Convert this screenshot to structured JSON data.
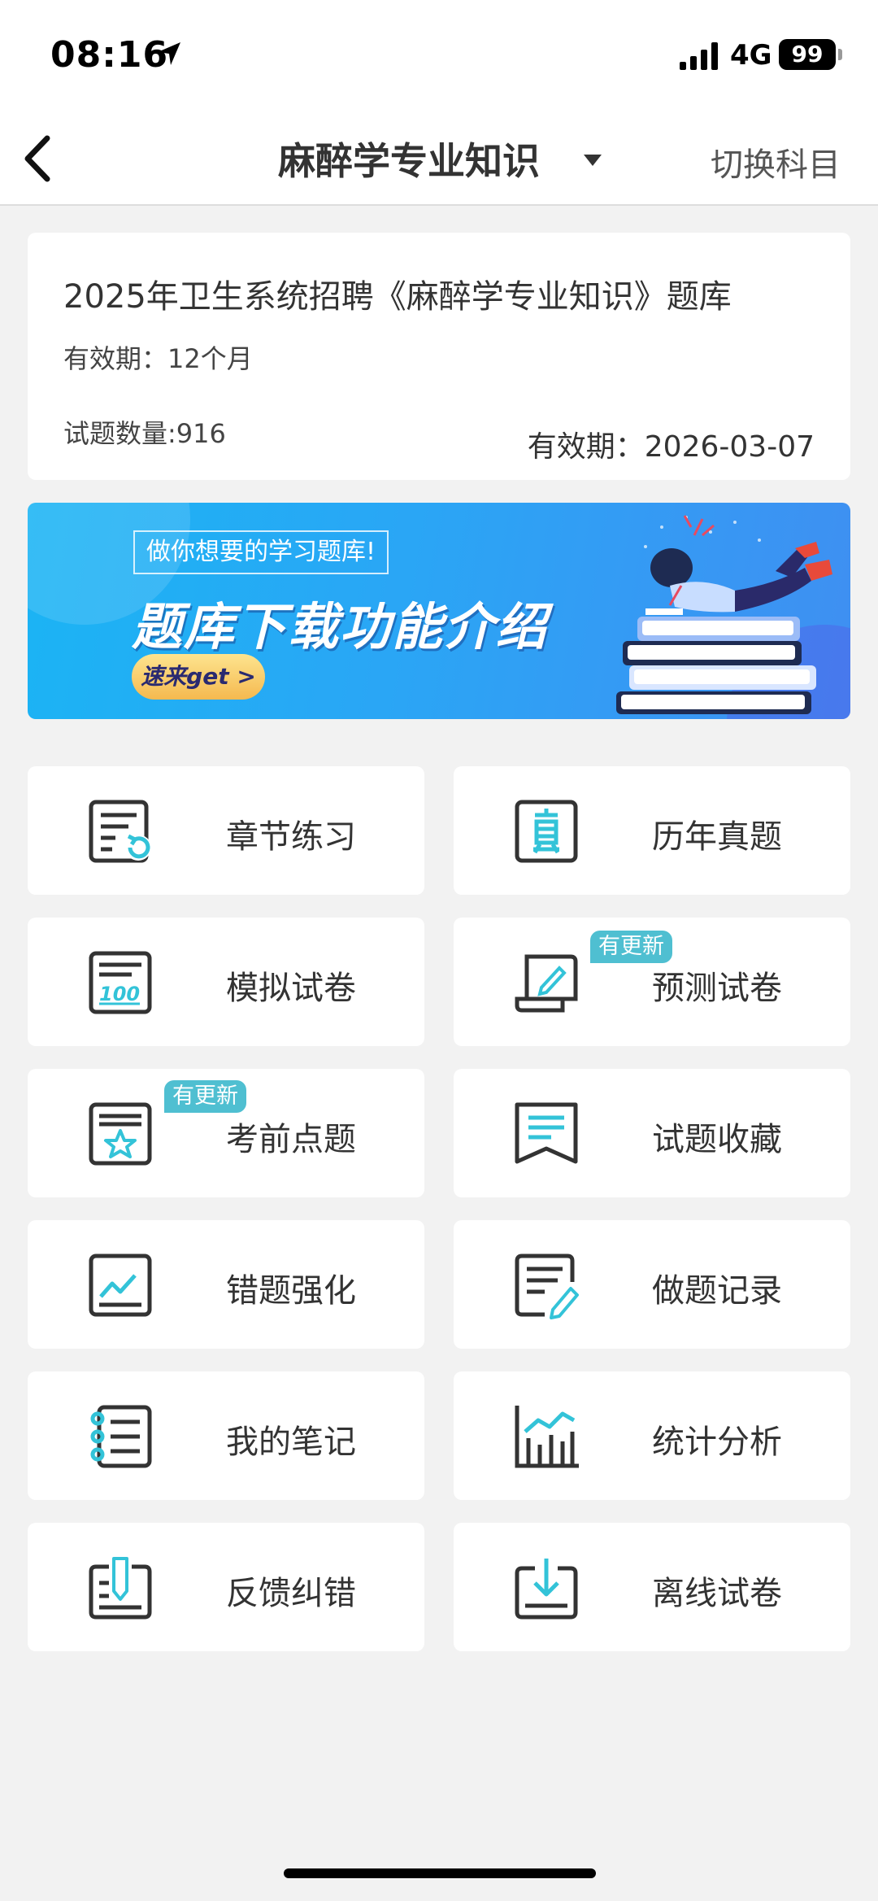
{
  "status_bar": {
    "time": "08:16",
    "network": "4G",
    "battery": "99"
  },
  "nav": {
    "title": "麻醉学专业知识",
    "switch_label": "切换科目"
  },
  "info": {
    "title": "2025年卫生系统招聘《麻醉学专业知识》题库",
    "period": "有效期：12个月",
    "count": "试题数量:916",
    "expiry": "有效期：2026-03-07"
  },
  "banner": {
    "tag": "做你想要的学习题库!",
    "headline": "题库下载功能介绍",
    "button": "速来get >"
  },
  "badge_text": "有更新",
  "tiles": [
    {
      "label": "章节练习",
      "icon": "chapter-practice-icon"
    },
    {
      "label": "历年真题",
      "icon": "past-exams-icon"
    },
    {
      "label": "模拟试卷",
      "icon": "mock-exam-icon"
    },
    {
      "label": "预测试卷",
      "icon": "prediction-exam-icon"
    },
    {
      "label": "考前点题",
      "icon": "key-points-icon"
    },
    {
      "label": "试题收藏",
      "icon": "favorites-icon"
    },
    {
      "label": "错题强化",
      "icon": "wrong-questions-icon"
    },
    {
      "label": "做题记录",
      "icon": "practice-record-icon"
    },
    {
      "label": "我的笔记",
      "icon": "notes-icon"
    },
    {
      "label": "统计分析",
      "icon": "statistics-icon"
    },
    {
      "label": "反馈纠错",
      "icon": "feedback-icon"
    },
    {
      "label": "离线试卷",
      "icon": "offline-exam-icon"
    }
  ],
  "colors": {
    "accent": "#33c3d8",
    "badge": "#4fbfd1",
    "banner": "#2aa6f5"
  }
}
